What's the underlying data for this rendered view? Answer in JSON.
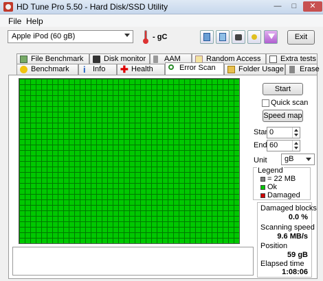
{
  "window": {
    "title": "HD Tune Pro 5.50 - Hard Disk/SSD Utility"
  },
  "menu": [
    "File",
    "Help"
  ],
  "toolbar": {
    "drive": "Apple   iPod (60 gB)",
    "temperature": "- ",
    "temperature_unit": "gC",
    "exit_label": "Exit",
    "icons": [
      "copy-info-icon",
      "copy-text-icon",
      "screenshot-camera-icon",
      "options-key-icon",
      "save-download-icon"
    ]
  },
  "tabs_row1": [
    {
      "label": "File Benchmark",
      "icon": "file-benchmark-icon"
    },
    {
      "label": "Disk monitor",
      "icon": "disk-monitor-icon"
    },
    {
      "label": "AAM",
      "icon": "speaker-icon"
    },
    {
      "label": "Random Access",
      "icon": "random-access-icon"
    },
    {
      "label": "Extra tests",
      "icon": "extra-tests-icon"
    }
  ],
  "tabs_row2": [
    {
      "label": "Benchmark",
      "icon": "benchmark-icon"
    },
    {
      "label": "Info",
      "icon": "info-icon"
    },
    {
      "label": "Health",
      "icon": "health-cross-icon"
    },
    {
      "label": "Error Scan",
      "icon": "magnifier-icon",
      "active": true
    },
    {
      "label": "Folder Usage",
      "icon": "folder-icon"
    },
    {
      "label": "Erase",
      "icon": "trash-icon"
    }
  ],
  "scan": {
    "block_color": "#00c800",
    "grid_color": "#007800"
  },
  "controls": {
    "start_button": "Start",
    "quick_scan_label": "Quick scan",
    "speed_map_button": "Speed map",
    "start_label": "Start",
    "start_value": "0",
    "end_label": "End",
    "end_value": "60",
    "unit_label": "Unit",
    "unit_value": "gB"
  },
  "legend": {
    "title": "Legend",
    "items": [
      {
        "label": "= 22 MB",
        "color": "#808080"
      },
      {
        "label": "Ok",
        "color": "#00c800"
      },
      {
        "label": "Damaged",
        "color": "#d00000"
      }
    ]
  },
  "stats": {
    "damaged_blocks_label": "Damaged blocks",
    "damaged_blocks_value": "0.0 %",
    "scanning_speed_label": "Scanning speed",
    "scanning_speed_value": "9.6 MB/s",
    "position_label": "Position",
    "position_value": "59 gB",
    "elapsed_time_label": "Elapsed time",
    "elapsed_time_value": "1:08:06"
  }
}
